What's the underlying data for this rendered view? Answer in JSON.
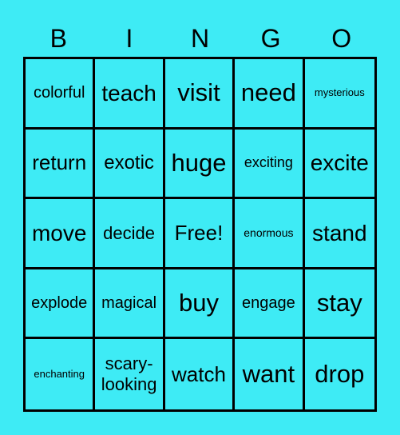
{
  "header": [
    "B",
    "I",
    "N",
    "G",
    "O"
  ],
  "board": [
    [
      "colorful",
      "teach",
      "visit",
      "need",
      "mysterious"
    ],
    [
      "return",
      "exotic",
      "huge",
      "exciting",
      "excite"
    ],
    [
      "move",
      "decide",
      "Free!",
      "enormous",
      "stand"
    ],
    [
      "explode",
      "magical",
      "buy",
      "engage",
      "stay"
    ],
    [
      "enchanting",
      "scary-looking",
      "watch",
      "want",
      "drop"
    ]
  ],
  "free_space_label": "Free!",
  "colors": {
    "background": "#3eebf5",
    "grid": "#000000",
    "text": "#000000"
  }
}
